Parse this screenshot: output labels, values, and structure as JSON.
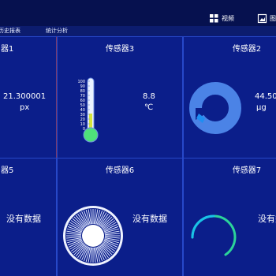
{
  "toolbar": {
    "video_label": "视频",
    "image_label": "图"
  },
  "nav": {
    "history_report": "历史报表",
    "statistics": "统计分析"
  },
  "panels": [
    {
      "title": "器1",
      "value": "21.300001",
      "unit": "px"
    },
    {
      "title": "传感器3",
      "value": "8.8",
      "unit": "℃",
      "level_fraction": 0.35
    },
    {
      "title": "传感器2",
      "value": "44.50",
      "unit": "μg",
      "fill_fraction": 0.95
    },
    {
      "title": "器5",
      "status": "没有数据"
    },
    {
      "title": "传感器6",
      "status": "没有数据"
    },
    {
      "title": "传感器7",
      "status": "没有数据"
    }
  ],
  "thermometer": {
    "scale_labels": [
      "100",
      "90",
      "80",
      "70",
      "60",
      "50",
      "40",
      "30",
      "20",
      "10",
      "0"
    ]
  },
  "icons": {
    "video": "grid-icon",
    "image": "picture-icon",
    "thermometer": "thermometer-icon",
    "ring_gauge": "ring-gauge-icon",
    "dial": "radial-dial-icon",
    "arc_gauge": "arc-gauge-icon"
  },
  "colors": {
    "background": "#0a1a78",
    "panel_border": "#2748c8",
    "gauge_blue": "#4b83e6",
    "accent_cyan": "#19c2e8",
    "thermo_fill": "#4ee07a",
    "thermo_level": "#d4e53b",
    "arc_green": "#2bd39a"
  }
}
